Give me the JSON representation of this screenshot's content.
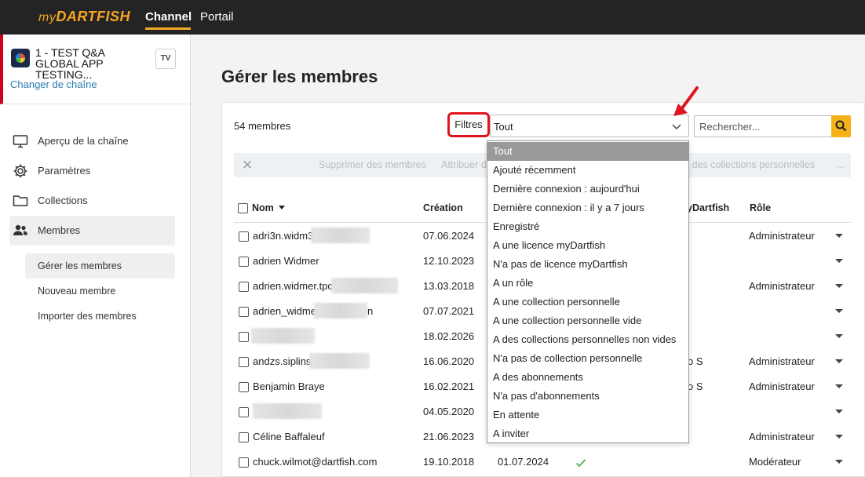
{
  "topbar": {
    "logo_prefix": "my",
    "logo_main": "DARTFISH",
    "tabs": [
      {
        "label": "Channel"
      },
      {
        "label": "Portail"
      }
    ]
  },
  "sidebar": {
    "channel_name": "1 - TEST Q&A GLOBAL APP TESTING...",
    "tv_label": "TV",
    "change_channel": "Changer de chaîne",
    "items": [
      {
        "label": "Aperçu de la chaîne",
        "icon": "monitor-icon"
      },
      {
        "label": "Paramètres",
        "icon": "gear-icon"
      },
      {
        "label": "Collections",
        "icon": "folder-icon"
      },
      {
        "label": "Membres",
        "icon": "users-icon"
      }
    ],
    "subitems": [
      {
        "label": "Gérer les membres"
      },
      {
        "label": "Nouveau membre"
      },
      {
        "label": "Importer des membres"
      }
    ]
  },
  "main": {
    "title": "Gérer les membres",
    "count": "54  membres",
    "filters_label": "Filtres",
    "filter_value": "Tout",
    "search_placeholder": "Rechercher...",
    "bulk_actions": [
      {
        "label": "Supprimer des membres"
      },
      {
        "label": "Attribuer d"
      },
      {
        "label": "r des collections personnelles"
      },
      {
        "label": "..."
      }
    ],
    "columns": [
      {
        "label": "Nom"
      },
      {
        "label": "Création"
      },
      {
        "label": "yDartfish"
      },
      {
        "label": "Rôle"
      }
    ],
    "rows": [
      {
        "name": "adri3n.widm3",
        "created": "07.06.2024",
        "col3": "",
        "role": "Administrateur"
      },
      {
        "name": "adrien Widmer",
        "created": "12.10.2023",
        "col3": "",
        "role": ""
      },
      {
        "name": "adrien.widmer.tpc",
        "created": "13.03.2018",
        "col3": "",
        "role": "Administrateur"
      },
      {
        "name": "adrien_widme",
        "name_tail": "n",
        "created": "07.07.2021",
        "col3": "",
        "role": ""
      },
      {
        "name": "",
        "created": "18.02.2026",
        "col3": "",
        "role": ""
      },
      {
        "name": "andzs.siplins",
        "created": "16.06.2020",
        "col3": "o S",
        "role": "Administrateur"
      },
      {
        "name": "Benjamin Braye",
        "created": "16.02.2021",
        "col3": "o S",
        "role": "Administrateur"
      },
      {
        "name": "",
        "created": "04.05.2020",
        "col3": "",
        "role": ""
      },
      {
        "name": "Céline Baffaleuf",
        "created": "21.06.2023",
        "col3": "",
        "role": "Administrateur"
      },
      {
        "name": "chuck.wilmot@dartfish.com",
        "created": "19.10.2018",
        "last": "01.07.2024",
        "col3": "",
        "role": "Modérateur"
      }
    ],
    "filter_options": [
      {
        "label": "Tout"
      },
      {
        "label": "Ajouté récemment"
      },
      {
        "label": "Dernière connexion : aujourd'hui"
      },
      {
        "label": "Dernière connexion : il y a 7 jours"
      },
      {
        "label": "Enregistré"
      },
      {
        "label": "A une licence myDartfish"
      },
      {
        "label": "N'a pas de licence myDartfish"
      },
      {
        "label": "A un rôle"
      },
      {
        "label": "A une collection personnelle"
      },
      {
        "label": "A une collection personnelle vide"
      },
      {
        "label": "A des collections personnelles non vides"
      },
      {
        "label": "N'a pas de collection personnelle"
      },
      {
        "label": "A des abonnements"
      },
      {
        "label": "N'a pas d'abonnements"
      },
      {
        "label": "En attente"
      },
      {
        "label": "A inviter"
      }
    ]
  },
  "colors": {
    "accent": "#f5a623",
    "highlight": "#e0141e",
    "link": "#2a7ab0",
    "topbar": "#242424"
  }
}
